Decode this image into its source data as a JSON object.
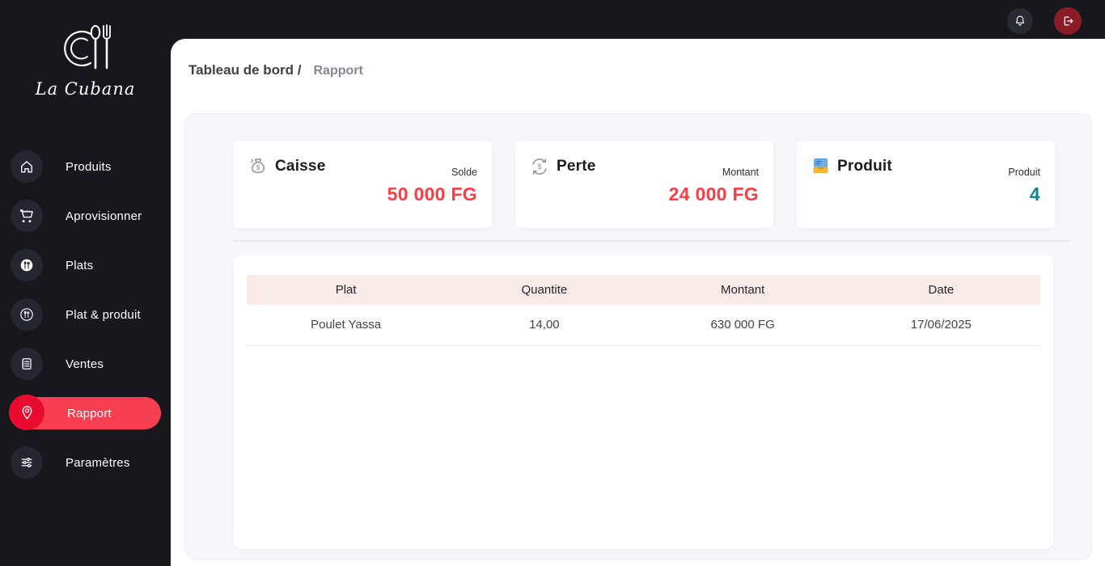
{
  "brand": {
    "name": "La Cubana",
    "logo_icon": "plate-cutlery-logo"
  },
  "topbar": {
    "bell_icon": "bell-icon",
    "logout_icon": "logout-icon"
  },
  "sidebar": {
    "items": [
      {
        "label": "Produits",
        "icon": "home-icon",
        "active": false
      },
      {
        "label": "Aprovisionner",
        "icon": "cart-icon",
        "active": false
      },
      {
        "label": "Plats",
        "icon": "dish-filled-icon",
        "active": false
      },
      {
        "label": "Plat & produit",
        "icon": "dish-outline-icon",
        "active": false
      },
      {
        "label": "Ventes",
        "icon": "receipt-list-icon",
        "active": false
      },
      {
        "label": "Rapport",
        "icon": "location-pin-icon",
        "active": true
      },
      {
        "label": "Paramètres",
        "icon": "sliders-icon",
        "active": false
      }
    ]
  },
  "breadcrumb": {
    "section": "Tableau de bord /",
    "current": "Rapport"
  },
  "cards": [
    {
      "title": "Caisse",
      "icon": "money-bag-icon",
      "label": "Solde",
      "value": "50 000 FG",
      "value_color": "#fb3d43"
    },
    {
      "title": "Perte",
      "icon": "currency-exchange-icon",
      "label": "Montant",
      "value": "24 000 FG",
      "value_color": "#fb3d43"
    },
    {
      "title": "Produit",
      "icon": "card-file-box-icon",
      "label": "Produit",
      "value": "4",
      "value_color": "#12828c"
    }
  ],
  "table": {
    "headers": [
      "Plat",
      "Quantite",
      "Montant",
      "Date"
    ],
    "rows": [
      [
        "Poulet Yassa",
        "14,00",
        "630 000 FG",
        "17/06/2025"
      ]
    ]
  },
  "colors": {
    "dark_bg": "#17171d",
    "icon_circle": "#262630",
    "active_pill_red": "#f83e51",
    "active_icon_red": "#ea0c2e",
    "logout_bg": "#8c1b28",
    "value_red": "#fb3d43",
    "value_teal": "#12828c",
    "panel_bg": "#f7f7fb",
    "table_header_bg": "#f9ebe8"
  }
}
